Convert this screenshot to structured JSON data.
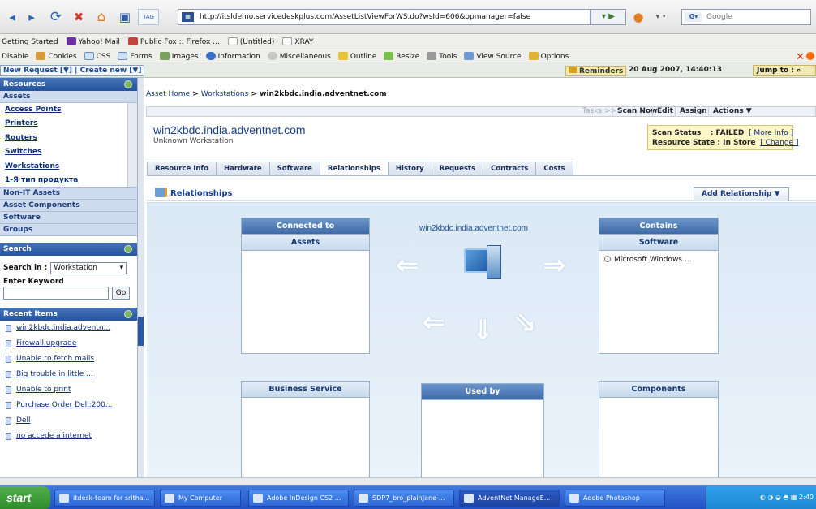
{
  "browser": {
    "url": "http://itsldemo.servicedeskplus.com/AssetListViewForWS.do?wsId=606&opmanager=false",
    "url_icon_text": "TAG",
    "search_placeholder": "Google",
    "search_icon_text": "G",
    "bookmarks": [
      "Getting Started",
      "Yahoo! Mail",
      "Public Fox :: Firefox ...",
      "(Untitled)",
      "XRAY"
    ],
    "webdev_tools": [
      "Disable",
      "Cookies",
      "CSS",
      "Forms",
      "Images",
      "Information",
      "Miscellaneous",
      "Outline",
      "Resize",
      "Tools",
      "View Source",
      "Options"
    ]
  },
  "app_header": {
    "new_request": "New Request",
    "create_new": "Create new",
    "reminders": "Reminders",
    "datetime": "20 Aug 2007, 14:40:13",
    "jump_to": "Jump to :"
  },
  "sidebar": {
    "resources_title": "Resources",
    "assets_header": "Assets",
    "asset_items": [
      "Access Points",
      "Printers",
      "Routers",
      "Switches",
      "Workstations",
      "1-Я тип продукта"
    ],
    "non_it": "Non-IT Assets",
    "asset_components": "Asset Components",
    "software": "Software",
    "groups": "Groups",
    "search_title": "Search",
    "search_in_label": "Search in :",
    "search_in_value": "Workstation",
    "keyword_label": "Enter Keyword",
    "go_label": "Go",
    "recent_title": "Recent Items",
    "recent_items": [
      "win2kbdc.india.adventn...",
      "Firewall upgrade",
      "Unable to fetch mails",
      "Big trouble in little ...",
      "Unable to print",
      "Purchase Order Dell:200...",
      "Dell",
      "no accede a internet"
    ]
  },
  "main": {
    "breadcrumb": {
      "home": "Asset Home",
      "sep": ">",
      "workstations": "Workstations",
      "current": "win2kbdc.india.adventnet.com"
    },
    "actions": {
      "tasks": "Tasks >>",
      "scan_now": "Scan Now",
      "edit": "Edit",
      "assign": "Assign",
      "actions": "Actions ▼"
    },
    "host_title": "win2kbdc.india.adventnet.com",
    "host_subtitle": "Unknown Workstation",
    "scan_status_label": "Scan Status",
    "scan_status_value": ": FAILED",
    "more_info": "[ More Info ]",
    "resource_state_label": "Resource State : In Store",
    "change": "[ Change ]",
    "tabs": [
      "Resource Info",
      "Hardware",
      "Software",
      "Relationships",
      "History",
      "Requests",
      "Contracts",
      "Costs"
    ],
    "active_tab": "Relationships",
    "relationships_title": "Relationships",
    "add_relationship": "Add Relationship ▼"
  },
  "diagram": {
    "center_title": "win2kbdc.india.adventnet.com",
    "connected_to": "Connected to",
    "assets": "Assets",
    "business_service": "Business Service",
    "contains": "Contains",
    "software": "Software",
    "software_item": "Microsoft Windows ...",
    "used_by": "Used by",
    "components": "Components"
  },
  "taskbar": {
    "start": "start",
    "items": [
      "itdesk-team for sritha...",
      "My Computer",
      "Adobe InDesign CS2 ...",
      "SDP7_bro_plainJane-...",
      "AdventNet ManageE...",
      "Adobe Photoshop"
    ],
    "clock": "2:40"
  },
  "colors": {
    "accent": "#24549d",
    "title_blue": "#13408c",
    "failed_box": "#fff6c6",
    "taskbar": "#2452c4"
  }
}
